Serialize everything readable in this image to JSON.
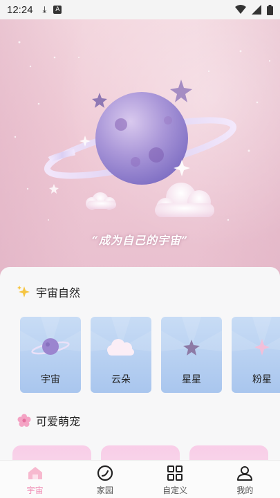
{
  "status_bar": {
    "time": "12:24"
  },
  "hero": {
    "slogan": "“成为自己的宇宙”"
  },
  "sections": [
    {
      "title": "宇宙自然",
      "icon": "sparkle-icon",
      "items": [
        {
          "label": "宇宙",
          "icon": "planet-icon"
        },
        {
          "label": "云朵",
          "icon": "cloud-icon"
        },
        {
          "label": "星星",
          "icon": "star-icon"
        },
        {
          "label": "粉星",
          "icon": "pink-star-icon"
        }
      ]
    },
    {
      "title": "可爱萌宠",
      "icon": "flower-icon"
    }
  ],
  "tabbar": {
    "active": "home",
    "tabs": [
      {
        "label": "宇宙",
        "icon": "home-icon"
      },
      {
        "label": "家园",
        "icon": "circle-icon"
      },
      {
        "label": "自定义",
        "icon": "grid-icon"
      },
      {
        "label": "我的",
        "icon": "person-icon"
      }
    ]
  },
  "colors": {
    "accent": "#f08db4",
    "card_blue": "#b6cff1",
    "hero_pink": "#efc9d5"
  }
}
